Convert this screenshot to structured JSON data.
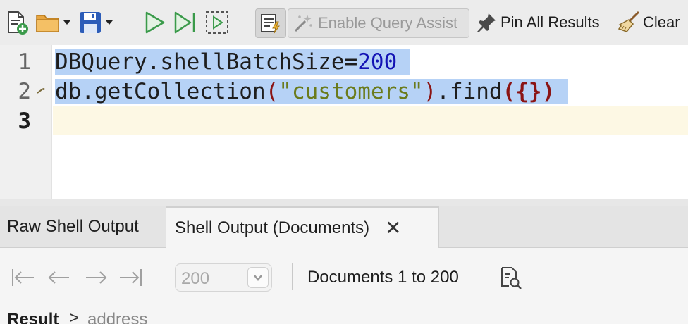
{
  "toolbar": {
    "enable_query_assist": "Enable Query Assist",
    "pin_all_results": "Pin All Results",
    "clear": "Clear"
  },
  "editor": {
    "line_numbers": [
      "1",
      "2",
      "3"
    ],
    "line1": {
      "ident": "DBQuery.shellBatchSize=",
      "number": "200"
    },
    "line2": {
      "ident": "db.getCollection",
      "open_paren": "(",
      "string": "\"customers\"",
      "close_paren": ")",
      "method": ".find",
      "args": "({})"
    },
    "selection_color": "#b6d2f6",
    "current_line_color": "#fdf8e4"
  },
  "tabs": [
    {
      "label": "Raw Shell Output",
      "active": false
    },
    {
      "label": "Shell Output (Documents)",
      "active": true,
      "close": "✕"
    }
  ],
  "nav": {
    "page_size": "200",
    "documents_label": "Documents 1 to 200"
  },
  "breadcrumb": {
    "root": "Result",
    "separator": ">",
    "child": "address"
  },
  "colors": {
    "run_green": "#3a9a4a",
    "save_blue": "#2c5cb8",
    "folder_orange": "#e8a640"
  }
}
